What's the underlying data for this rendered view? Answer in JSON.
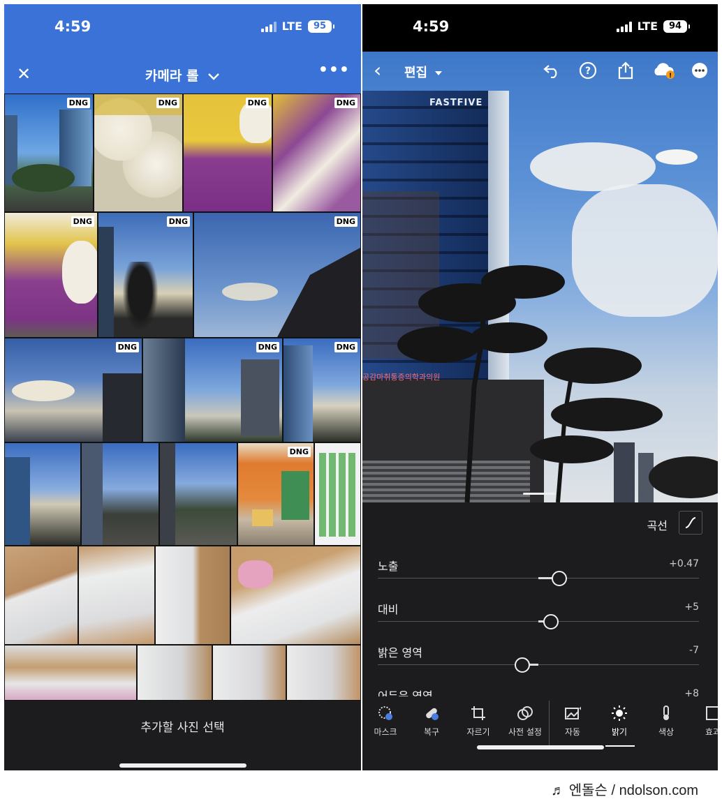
{
  "left_phone": {
    "status": {
      "time": "4:59",
      "network": "LTE",
      "battery": "95"
    },
    "nav": {
      "close_icon": "close-icon",
      "title": "카메라 롤",
      "chevron": "chevron-down-icon",
      "more_icon": "more-horizontal-icon"
    },
    "badge": "DNG",
    "bottom": {
      "select_label": "추가할 사진 선택"
    }
  },
  "right_phone": {
    "status": {
      "time": "4:59",
      "network": "LTE",
      "battery": "94"
    },
    "toolbar": {
      "title": "편집",
      "icons": [
        "back-icon",
        "undo-icon",
        "help-icon",
        "share-icon",
        "cloud-warning-icon",
        "more-icon"
      ]
    },
    "photo": {
      "sign_text": "FASTFIVE",
      "shop_text": "공감마취통증의학과의원"
    },
    "panel": {
      "curve_label": "곡선",
      "sliders": [
        {
          "label": "노출",
          "value": "+0.47",
          "level": 0.565
        },
        {
          "label": "대비",
          "value": "+5",
          "level": 0.54
        },
        {
          "label": "밝은 영역",
          "value": "-7",
          "level": 0.45
        },
        {
          "label": "어두운 영역",
          "value": "+8",
          "level": 0.55
        }
      ]
    },
    "tools": [
      {
        "label": "마스크",
        "icon": "mask-icon"
      },
      {
        "label": "복구",
        "icon": "heal-icon"
      },
      {
        "label": "자르기",
        "icon": "crop-icon"
      },
      {
        "label": "사전 설정",
        "icon": "presets-icon"
      },
      {
        "label": "자동",
        "icon": "auto-icon"
      },
      {
        "label": "밝기",
        "icon": "brightness-icon",
        "active": true
      },
      {
        "label": "색상",
        "icon": "color-temperature-icon"
      },
      {
        "label": "효과",
        "icon": "effects-icon"
      }
    ]
  },
  "watermark": "♬ 엔돌슨 / ndolson.com"
}
